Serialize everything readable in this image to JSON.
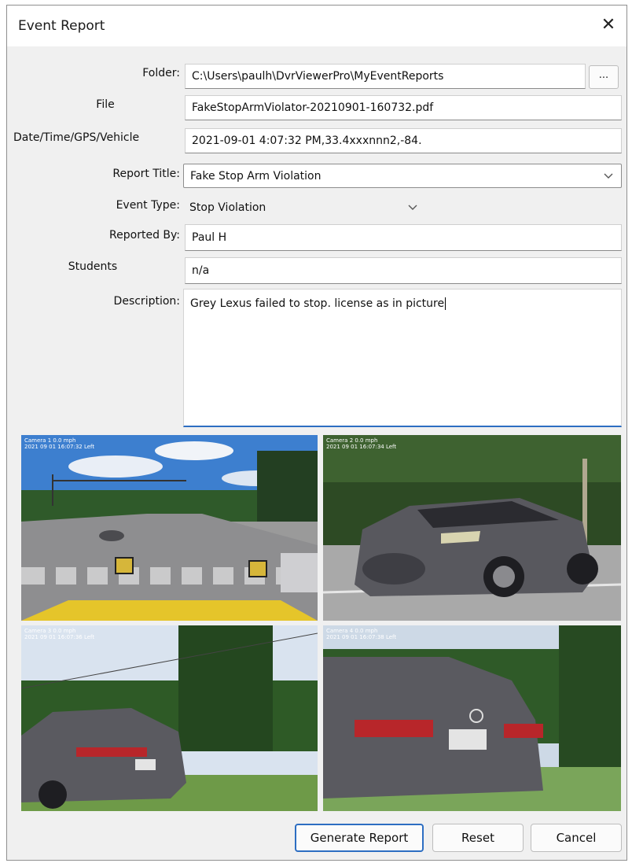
{
  "window": {
    "title": "Event Report",
    "close_glyph": "✕"
  },
  "form": {
    "folder": {
      "label": "Folder:",
      "value": "C:\\Users\\paulh\\DvrViewerPro\\MyEventReports",
      "browse_label": "..."
    },
    "file": {
      "label": "File",
      "value": "FakeStopArmViolator-20210901-160732.pdf"
    },
    "datetime": {
      "label": "Date/Time/GPS/Vehicle",
      "value": "2021-09-01 4:07:32 PM,33.4xxxnnn2,-84."
    },
    "report_title": {
      "label": "Report Title:",
      "value": "Fake Stop Arm Violation"
    },
    "event_type": {
      "label": "Event Type:",
      "value": "Stop Violation"
    },
    "reported_by": {
      "label": "Reported By:",
      "value": "Paul H"
    },
    "students": {
      "label": "Students",
      "value": "n/a"
    },
    "description": {
      "label": "Description:",
      "value": "Grey Lexus failed to stop. license as in picture"
    }
  },
  "images": [
    {
      "overlay_line1": "Camera 1  0.0 mph",
      "overlay_line2": "2021 09 01 16:07:32  Left"
    },
    {
      "overlay_line1": "Camera 2  0.0 mph",
      "overlay_line2": "2021 09 01 16:07:34  Left"
    },
    {
      "overlay_line1": "Camera 3  0.0 mph",
      "overlay_line2": "2021 09 01 16:07:36  Left"
    },
    {
      "overlay_line1": "Camera 4  0.0 mph",
      "overlay_line2": "2021 09 01 16:07:38  Left"
    }
  ],
  "buttons": {
    "generate": "Generate Report",
    "reset": "Reset",
    "cancel": "Cancel"
  },
  "colors": {
    "accent": "#2d6ec2",
    "dialog_bg": "#f0f0f0",
    "car_grey": "#5a5a60"
  }
}
